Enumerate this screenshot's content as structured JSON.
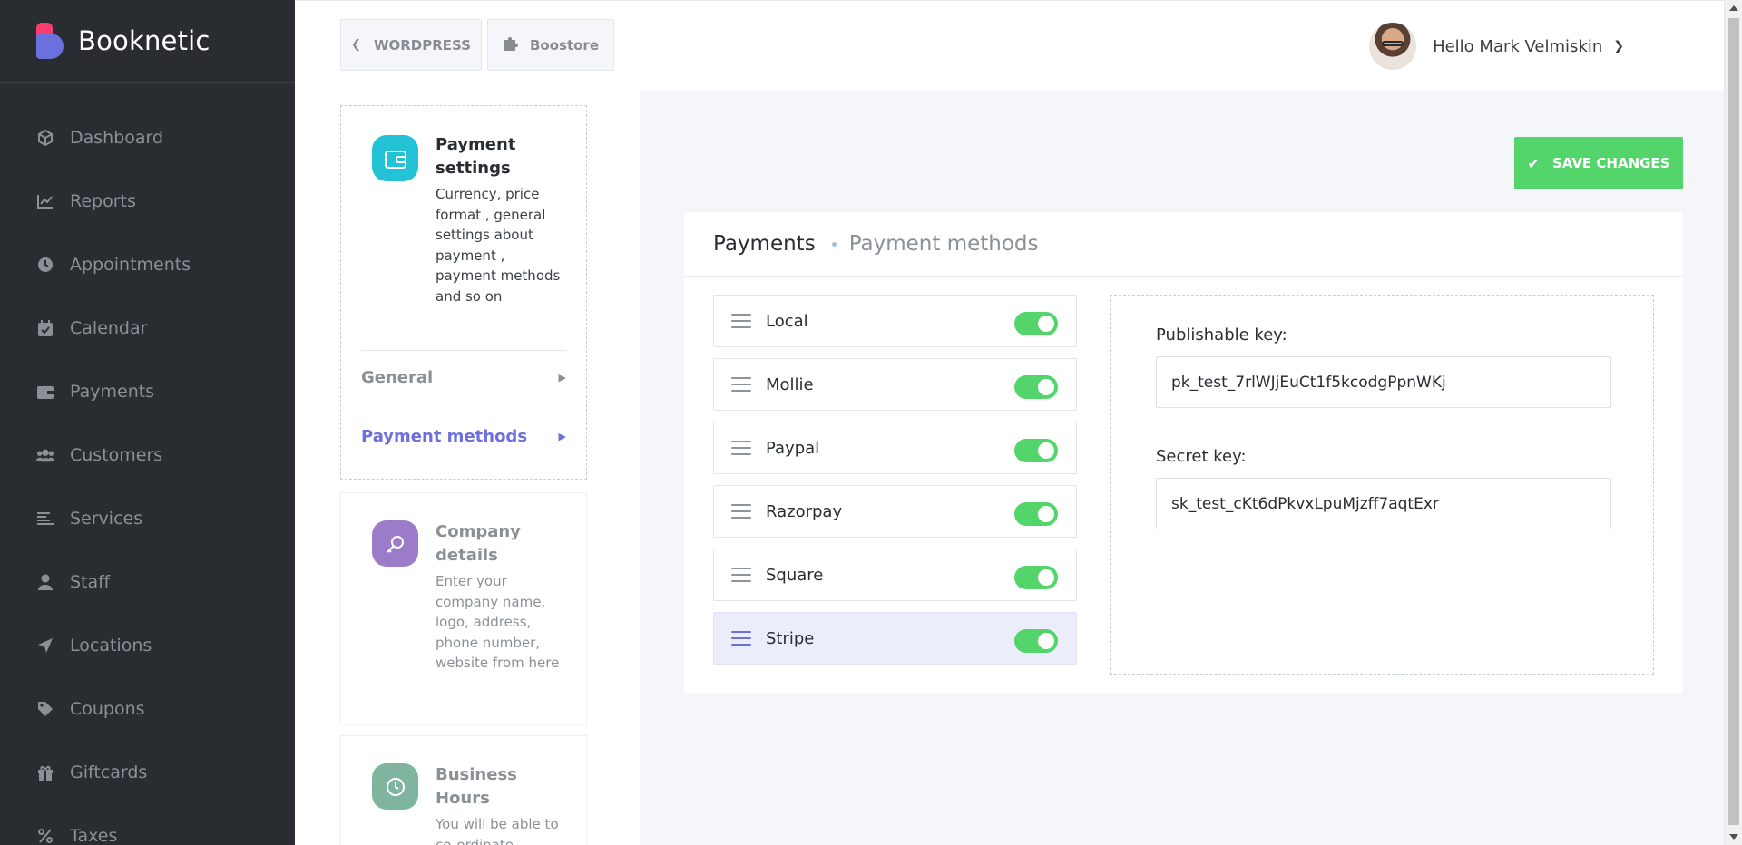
{
  "brand": {
    "name": "Booknetic",
    "colors": {
      "pink": "#fb3e6e",
      "purple": "#6c70dc",
      "green": "#53d56c",
      "sidebar": "#292d32"
    }
  },
  "sidebar": {
    "items": [
      {
        "label": "Dashboard",
        "icon": "cube-icon"
      },
      {
        "label": "Reports",
        "icon": "chart-line-icon"
      },
      {
        "label": "Appointments",
        "icon": "clock-icon"
      },
      {
        "label": "Calendar",
        "icon": "calendar-check-icon"
      },
      {
        "label": "Payments",
        "icon": "wallet-icon"
      },
      {
        "label": "Customers",
        "icon": "users-icon"
      },
      {
        "label": "Services",
        "icon": "list-icon"
      },
      {
        "label": "Staff",
        "icon": "user-icon"
      },
      {
        "label": "Locations",
        "icon": "location-arrow-icon"
      },
      {
        "label": "Coupons",
        "icon": "tag-icon"
      },
      {
        "label": "Giftcards",
        "icon": "gift-icon"
      },
      {
        "label": "Taxes",
        "icon": "percent-icon"
      }
    ]
  },
  "topbar": {
    "back_label": "WORDPRESS",
    "store_label": "Boostore",
    "greeting": "Hello Mark Velmiskin"
  },
  "settings_nav": {
    "payment": {
      "title": "Payment settings",
      "description": "Currency, price format , general settings about payment , payment methods and so on",
      "icon_color": "#24c2d6",
      "subitems": [
        {
          "label": "General",
          "active": false
        },
        {
          "label": "Payment methods",
          "active": true
        }
      ]
    },
    "company": {
      "title": "Company details",
      "description": "Enter your company name, logo, address, phone number, website from here",
      "icon_color": "#9c7bc9"
    },
    "hours": {
      "title": "Business Hours",
      "description": "You will be able to co-ordinate",
      "icon_color": "#7fb59f"
    }
  },
  "main": {
    "save_label": "SAVE CHANGES",
    "breadcrumb": {
      "title": "Payments",
      "sub": "Payment methods"
    },
    "methods": [
      {
        "label": "Local",
        "enabled": true,
        "active": false
      },
      {
        "label": "Mollie",
        "enabled": true,
        "active": false
      },
      {
        "label": "Paypal",
        "enabled": true,
        "active": false
      },
      {
        "label": "Razorpay",
        "enabled": true,
        "active": false
      },
      {
        "label": "Square",
        "enabled": true,
        "active": false
      },
      {
        "label": "Stripe",
        "enabled": true,
        "active": true
      }
    ],
    "keys": {
      "publishable_label": "Publishable key:",
      "publishable_value": "pk_test_7rlWJjEuCt1f5kcodgPpnWKj",
      "secret_label": "Secret key:",
      "secret_value": "sk_test_cKt6dPkvxLpuMjzff7aqtExr"
    }
  }
}
